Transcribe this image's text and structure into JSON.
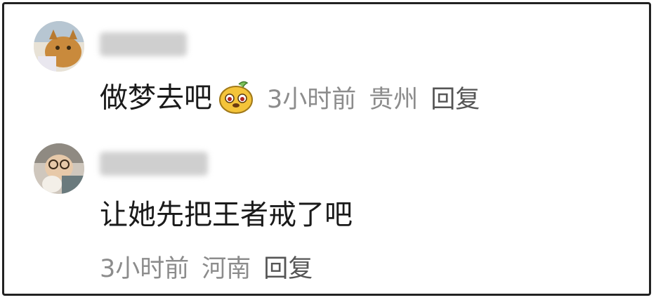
{
  "comments": [
    {
      "text": "做梦去吧",
      "emoji": "dog-face-sticker-icon",
      "time": "3小时前",
      "location": "贵州",
      "reply_label": "回复"
    },
    {
      "text": "让她先把王者戒了吧",
      "time": "3小时前",
      "location": "河南",
      "reply_label": "回复"
    }
  ]
}
